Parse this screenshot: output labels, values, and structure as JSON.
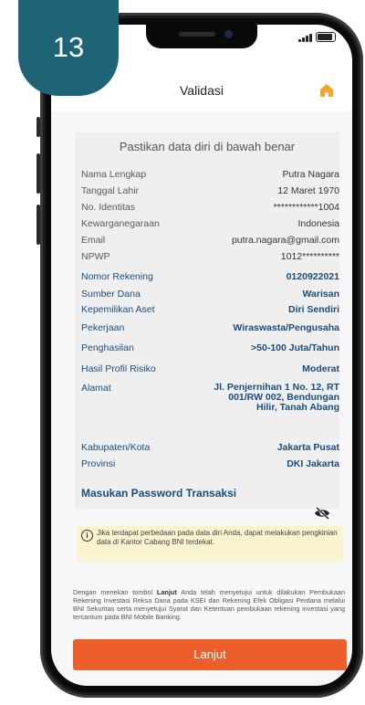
{
  "step_badge": "13",
  "header": {
    "title": "Validasi",
    "back_arrow": "‹"
  },
  "card": {
    "title": "Pastikan data diri di bawah benar",
    "rows_personal": [
      {
        "label": "Nama Lengkap",
        "value": "Putra Nagara"
      },
      {
        "label": "Tanggal Lahir",
        "value": "12 Maret 1970"
      },
      {
        "label": "No. Identitas",
        "value": "************1004"
      },
      {
        "label": "Kewarganegaraan",
        "value": "Indonesia"
      },
      {
        "label": "Email",
        "value": "putra.nagara@gmail.com"
      },
      {
        "label": "NPWP",
        "value": "1012**********"
      }
    ],
    "rows_account": [
      {
        "label": "Nomor Rekening",
        "value": "0120922021"
      },
      {
        "label": "Sumber Dana",
        "value": "Warisan"
      },
      {
        "label": "Kepemilikan Aset",
        "value": "Diri Sendiri"
      },
      {
        "label": "Pekerjaan",
        "value": "Wiraswasta/Pengusaha"
      },
      {
        "label": "Penghasilan",
        "value": ">50-100 Juta/Tahun"
      },
      {
        "label": "Hasil Profil Risiko",
        "value": "Moderat"
      },
      {
        "label": "Alamat",
        "value": "Jl. Penjernihan 1 No. 12, RT 001/RW 002, Bendungan Hilir, Tanah Abang"
      },
      {
        "label": "Kabupaten/Kota",
        "value": "Jakarta Pusat"
      },
      {
        "label": "Provinsi",
        "value": "DKI Jakarta"
      }
    ],
    "password_label": "Masukan Password Transaksi"
  },
  "notice": {
    "icon": "i",
    "text": "Jika terdapat perbedaan pada data diri Anda, dapat melakukan pengkinian data di Kantor Cabang BNI terdekat."
  },
  "disclaimer": {
    "prefix": "Dengan menekan tombol ",
    "bold": "Lanjut",
    "suffix": " Anda telah menyetujui untuk dilakukan Pembukaan Rekening Investasi Reksa Dana pada KSEI dan Rekening Efek Obligasi Perdana melalui BNI Sekuritas serta menyetujui Syarat dan Ketentuan pembukaan rekening investasi yang tercantum pada BNI Mobile Banking."
  },
  "button": {
    "label": "Lanjut"
  },
  "colors": {
    "accent": "#ec5f2a",
    "label_blue": "#1a4d7a",
    "badge": "#1e6476",
    "home_icon": "#f5a623"
  },
  "icons": {
    "home": "home-icon",
    "eye": "eye-slash-icon",
    "info": "info-icon"
  }
}
